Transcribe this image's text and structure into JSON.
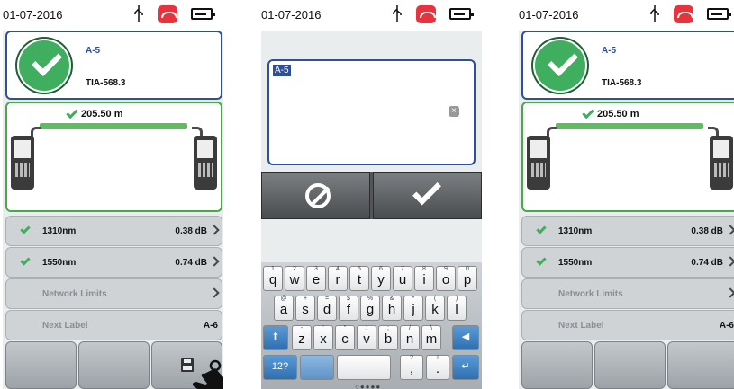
{
  "status": {
    "date": "01-07-2016",
    "icons": [
      "usb-icon",
      "phone-icon",
      "battery-icon"
    ]
  },
  "result": {
    "cable_id": "A-5",
    "standard": "TIA-568.3"
  },
  "link": {
    "length": "205.50 m"
  },
  "measurements": [
    {
      "label": "1310nm",
      "value": "0.38 dB"
    },
    {
      "label": "1550nm",
      "value": "0.74 dB"
    }
  ],
  "network_limits": {
    "label": "Network Limits"
  },
  "next_label": {
    "label": "Next Label",
    "value": "A-6"
  },
  "edit": {
    "text": "A-5",
    "clear_glyph": "×"
  },
  "keyboard": {
    "row1": [
      {
        "main": "q",
        "alt": "1"
      },
      {
        "main": "w",
        "alt": "2"
      },
      {
        "main": "e",
        "alt": "3"
      },
      {
        "main": "r",
        "alt": "4"
      },
      {
        "main": "t",
        "alt": "5"
      },
      {
        "main": "y",
        "alt": "6"
      },
      {
        "main": "u",
        "alt": "7"
      },
      {
        "main": "i",
        "alt": "8"
      },
      {
        "main": "o",
        "alt": "9"
      },
      {
        "main": "p",
        "alt": "0"
      }
    ],
    "row2": [
      {
        "main": "a",
        "alt": "@"
      },
      {
        "main": "s",
        "alt": "+"
      },
      {
        "main": "d",
        "alt": "="
      },
      {
        "main": "f",
        "alt": "$"
      },
      {
        "main": "g",
        "alt": "%"
      },
      {
        "main": "h",
        "alt": "&"
      },
      {
        "main": "j",
        "alt": "*"
      },
      {
        "main": "k",
        "alt": "("
      },
      {
        "main": "l",
        "alt": ")"
      }
    ],
    "row3": [
      {
        "main": "z",
        "alt": "-"
      },
      {
        "main": "x",
        "alt": "'"
      },
      {
        "main": "c",
        "alt": "\""
      },
      {
        "main": "v",
        "alt": ":"
      },
      {
        "main": "b",
        "alt": ";"
      },
      {
        "main": "n",
        "alt": "/"
      },
      {
        "main": "m",
        "alt": "\\"
      }
    ],
    "shift": "⬆",
    "backspace": "◀",
    "mode": "12?",
    "comma": ",",
    "period": ".",
    "enter": "↵",
    "comma_alt": "?",
    "period_alt": "!",
    "page_dots": "○●●●●"
  },
  "colors": {
    "accent": "#2e4f9c",
    "pass": "#3fae5e",
    "fiber": "#5ebd5e",
    "alert": "#e8323c",
    "key_blue": "#2f6fb0"
  }
}
